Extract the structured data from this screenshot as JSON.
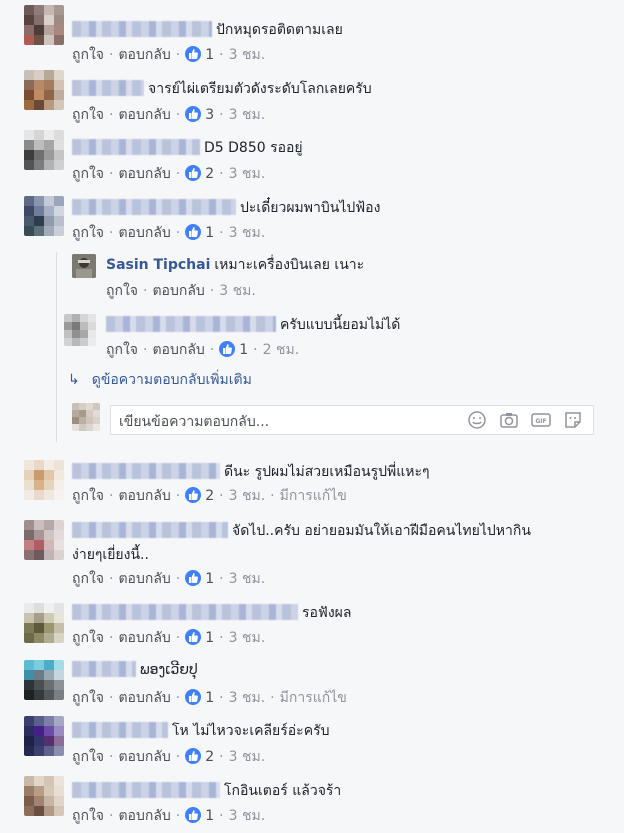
{
  "actions": {
    "like": "ถูกใจ",
    "reply": "ตอบกลับ",
    "sep": "·",
    "edited": "มีการแก้ไข"
  },
  "comments": [
    {
      "author_suffix": "",
      "text": "ปักหมุดรอติดตามเลย",
      "likes": "1",
      "time": "3 ชม."
    },
    {
      "author_suffix": "",
      "text": "จารย์ไผ่เตรียมตัวดังระดับโลกเลยครับ",
      "likes": "3",
      "time": "3 ชม."
    },
    {
      "author_suffix": "",
      "text": "D5 D850 รออยู่",
      "likes": "2",
      "time": "3 ชม."
    },
    {
      "author_suffix": "",
      "text": "ปะเดี๋ยวผมพาบินไปฟ้อง",
      "likes": "1",
      "time": "3 ชม."
    },
    {
      "author_suffix": "n",
      "text": "ดีนะ รูปผมไม่สวยเหมือนรูปพี่แหะๆ",
      "likes": "2",
      "time": "3 ชม.",
      "edited": true
    },
    {
      "author_suffix": "",
      "text": "จัดไป..ครับ อย่ายอมมันให้เอาฝีมือคนไทยไปหากิน",
      "text2": "ง่ายๆเยี่ยงนี้..",
      "likes": "1",
      "time": "3 ชม."
    },
    {
      "author_suffix": "",
      "text": "รอฟังผล",
      "likes": "1",
      "time": "3 ชม."
    },
    {
      "author_suffix": "",
      "text": "ພອງເວີຍປຸ",
      "likes": "1",
      "time": "3 ชม.",
      "edited": true
    },
    {
      "author_suffix": "",
      "text": "โห ไม่ไหวจะเคลียร์อ่ะครับ",
      "likes": "2",
      "time": "3 ชม."
    },
    {
      "author_suffix": "",
      "text": "โกอินเตอร์ แล้วจร้า",
      "likes": "1",
      "time": "3 ชม."
    }
  ],
  "replies": [
    {
      "author": "Sasin Tipchai",
      "text": "เหมาะเครื่องบินเลย เนาะ",
      "likes": "",
      "time": "3 ชม."
    },
    {
      "author_suffix": "g",
      "text": "ครับแบบนี้ยอมไม่ได้",
      "likes": "1",
      "time": "2 ชม."
    }
  ],
  "more_replies": "ดูข้อความตอบกลับเพิ่มเติม",
  "reply_box": {
    "placeholder": "เขียนข้อความตอบกลับ..."
  },
  "reply_box_icons": [
    "emoji-icon",
    "camera-icon",
    "gif-icon",
    "sticker-icon"
  ],
  "colors": {
    "link": "#365899",
    "like_badge": "#4080ff",
    "meta": "#90949c"
  }
}
